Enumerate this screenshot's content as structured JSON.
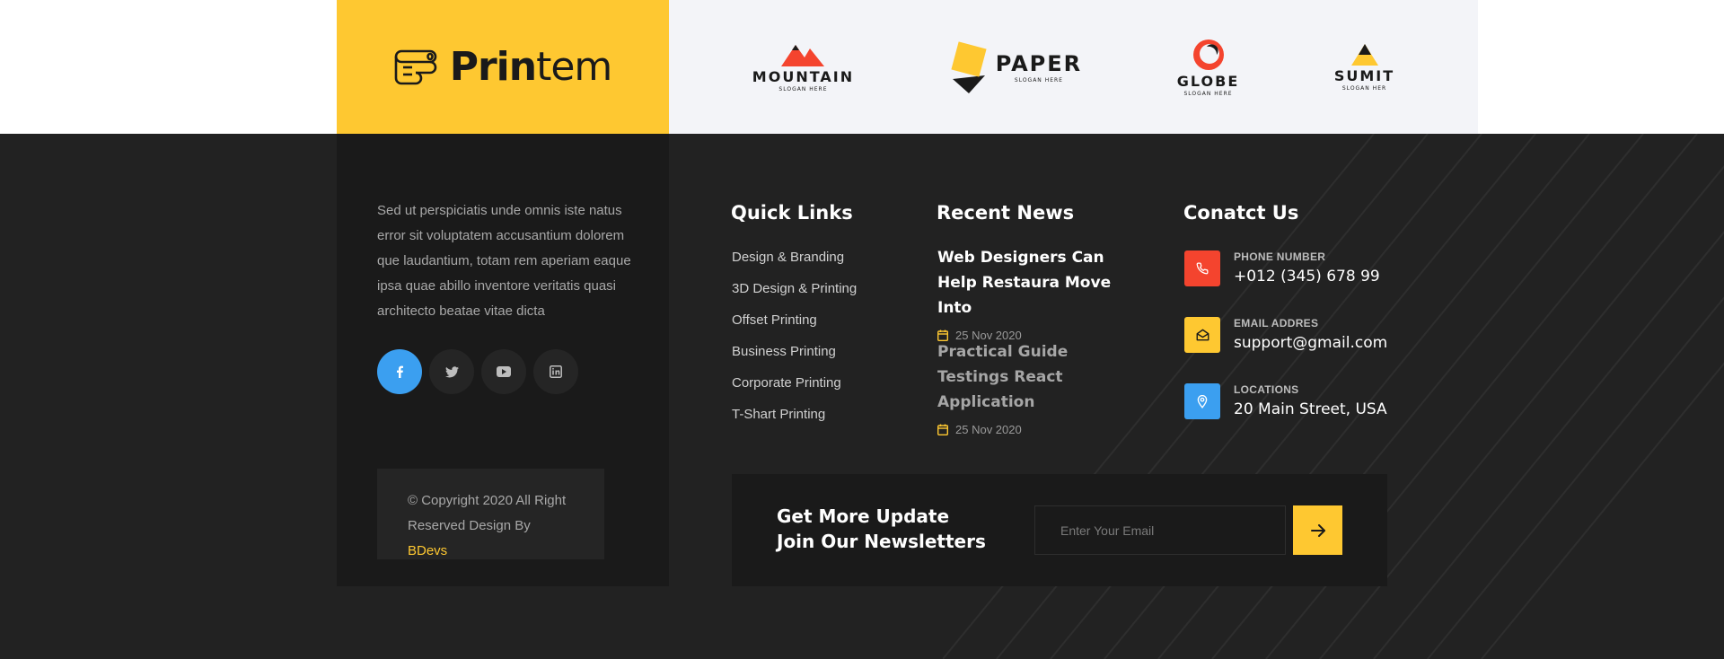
{
  "logo": {
    "bold": "Prin",
    "light": "tem"
  },
  "brands": [
    {
      "name": "MOUNTAIN",
      "sub": "SLOGAN HERE"
    },
    {
      "name": "PAPER",
      "sub": "SLOGAN HERE"
    },
    {
      "name": "GLOBE",
      "sub": "SLOGAN HERE"
    },
    {
      "name": "SUMIT",
      "sub": "SLOGAN HER"
    }
  ],
  "about": "Sed ut perspiciatis unde omnis iste natus error sit voluptatem accusantium dolorem que laudantium, totam rem aperiam eaque ipsa quae abillo inventore veritatis quasi architecto beatae vitae dicta",
  "socials": [
    "facebook-icon",
    "twitter-icon",
    "youtube-icon",
    "linkedin-icon"
  ],
  "copyright": {
    "text": "© Copyright 2020 All Right Reserved Design By ",
    "brand": "BDevs"
  },
  "quick_links": {
    "title": "Quick Links",
    "items": [
      "Design & Branding",
      "3D Design & Printing",
      "Offset Printing",
      "Business Printing",
      "Corporate Printing",
      "T-Shart Printing"
    ]
  },
  "recent_news": {
    "title": "Recent News",
    "items": [
      {
        "title": "Web Designers Can Help Restaura Move Into",
        "date": "25 Nov 2020"
      },
      {
        "title": "Practical Guide Testings React Application",
        "date": "25 Nov 2020"
      }
    ]
  },
  "contact": {
    "title": "Conatct Us",
    "items": [
      {
        "label": "PHONE NUMBER",
        "value": "+012 (345) 678 99",
        "color": "#f4442e",
        "icon": "phone-icon"
      },
      {
        "label": "EMAIL ADDRES",
        "value": "support@gmail.com",
        "color": "#fec831",
        "icon": "envelope-icon"
      },
      {
        "label": "LOCATIONS",
        "value": "20 Main Street, USA",
        "color": "#3b9ff0",
        "icon": "location-pin-icon"
      }
    ]
  },
  "newsletter": {
    "title": "Get More Update Join Our Newsletters",
    "placeholder": "Enter Your Email"
  },
  "colors": {
    "accent": "#fec831",
    "dark": "#1a1a1a",
    "bg": "#222222"
  }
}
